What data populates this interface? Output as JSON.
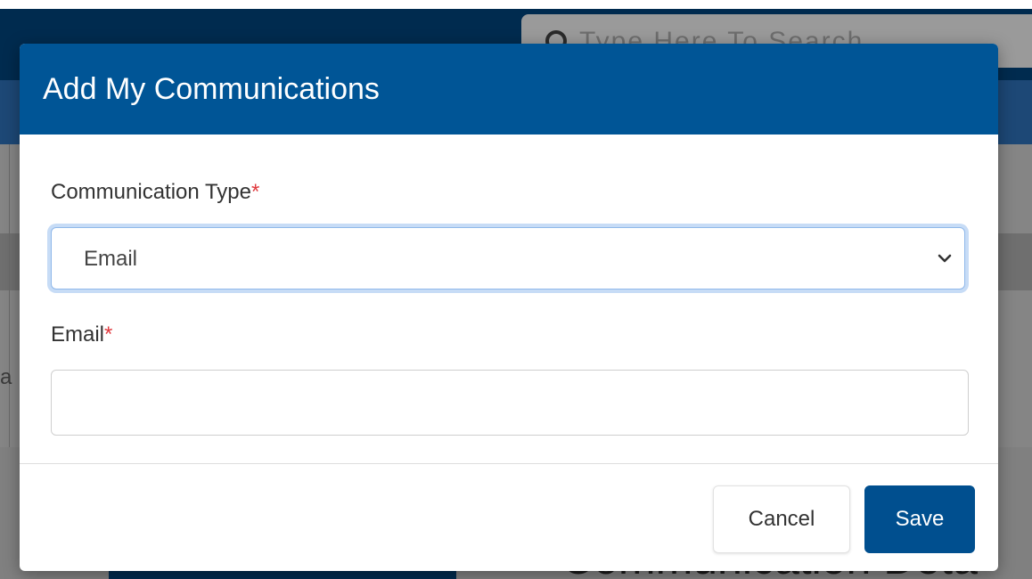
{
  "background": {
    "search_placeholder": "Type Here To Search",
    "heading_text": "Communication Deta",
    "left_fragment": "a"
  },
  "modal": {
    "title": "Add My Communications",
    "fields": {
      "communication_type": {
        "label": "Communication Type",
        "required_marker": "*",
        "selected_value": "Email"
      },
      "email": {
        "label": "Email",
        "required_marker": "*",
        "value": "",
        "placeholder": ""
      }
    },
    "buttons": {
      "cancel_label": "Cancel",
      "save_label": "Save"
    }
  },
  "icons": {
    "search": "search-icon",
    "select_chevron": "chevron-down-icon"
  },
  "colors": {
    "header_blue": "#005596",
    "save_button": "#004f8f",
    "required": "#e0393e",
    "navbar_dark": "#002b4f"
  }
}
